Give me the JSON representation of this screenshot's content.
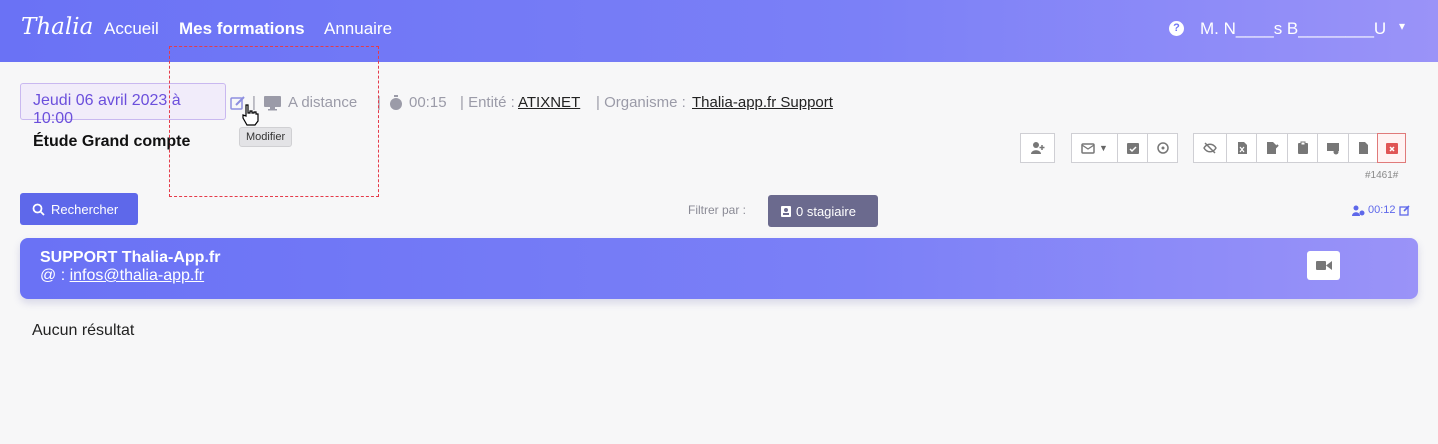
{
  "header": {
    "brand": "Thalia",
    "nav": [
      {
        "label": "Accueil"
      },
      {
        "label": "Mes formations"
      },
      {
        "label": "Annuaire"
      }
    ],
    "help": "?",
    "user": "M. N____s B________U",
    "caret": "▾"
  },
  "session": {
    "date": "Jeudi 06 avril 2023 à 10:00",
    "mode": "A distance",
    "duration": "00:15",
    "entity_label": "| Entité :",
    "entity": "ATIXNET",
    "org_label": "| Organisme :",
    "organism": "Thalia-app.fr Support",
    "tooltip": "Modifier",
    "title": "Étude Grand compte",
    "ref": "#1461#"
  },
  "toolbar": {
    "search_label": "Rechercher",
    "filter_label": "Filtrer par :",
    "filter_button": "0 stagiaire",
    "timer": "00:12"
  },
  "card": {
    "title": "SUPPORT Thalia-App.fr",
    "mail_prefix": "@ :",
    "email": "infos@thalia-app.fr"
  },
  "results": {
    "empty": "Aucun résultat"
  },
  "colors": {
    "primary": "#6a72f5",
    "accent": "#6b4fdc",
    "danger": "#e05555"
  }
}
